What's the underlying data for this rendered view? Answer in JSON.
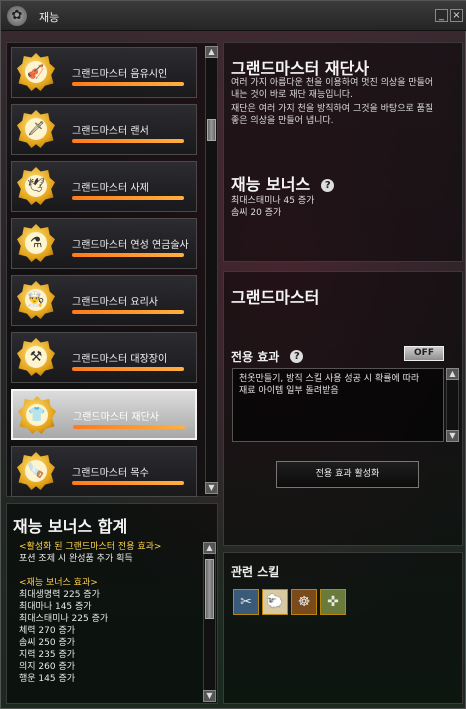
{
  "window": {
    "title": "재능",
    "minimize_label": "_",
    "close_label": "×"
  },
  "jobs": [
    {
      "name": "그랜드마스터 음유시인",
      "glyph": "🎻",
      "progress": 1.0,
      "selected": false
    },
    {
      "name": "그랜드마스터 랜서",
      "glyph": "🗡",
      "progress": 1.0,
      "selected": false
    },
    {
      "name": "그랜드마스터 사제",
      "glyph": "🕊",
      "progress": 1.0,
      "selected": false
    },
    {
      "name": "그랜드마스터 연성 연금술사",
      "glyph": "⚗",
      "progress": 1.0,
      "selected": false
    },
    {
      "name": "그랜드마스터 요리사",
      "glyph": "👨‍🍳",
      "progress": 1.0,
      "selected": false
    },
    {
      "name": "그랜드마스터 대장장이",
      "glyph": "⚒",
      "progress": 1.0,
      "selected": false
    },
    {
      "name": "그랜드마스터 재단사",
      "glyph": "👕",
      "progress": 1.0,
      "selected": true
    },
    {
      "name": "그랜드마스터 목수",
      "glyph": "🪚",
      "progress": 1.0,
      "selected": false
    }
  ],
  "info": {
    "title": "그랜드마스터 재단사",
    "desc1": "여러 가지 아름다운 천을 이용하여 멋진 의상을 만들어",
    "desc2": "내는 것이 바로 재단 재능입니다.",
    "desc3": "재단은 여러 가지 천을 방직하여 그것을 바탕으로 품질",
    "desc4": "좋은 의상을 만들어 냅니다.",
    "bonus_title": "재능 보너스",
    "bonus_line1": "최대스태미나 45 증가",
    "bonus_line2": "솜씨 20 증가"
  },
  "grandmaster": {
    "title": "그랜드마스터",
    "effect_label": "전용 효과",
    "toggle": "OFF",
    "effect_line1": "천옷만들기, 방직 스킬 사용 성공 시 확률에 따라",
    "effect_line2": "재료 아이템 일부 돌려받음",
    "activate_button": "전용 효과 활성화"
  },
  "skills": {
    "title": "관련 스킬",
    "icons": [
      "tailoring-icon",
      "sheep-icon",
      "spinning-wheel-icon",
      "weaving-icon"
    ]
  },
  "bonus_total": {
    "title": "재능 보너스 합계",
    "lines": [
      {
        "text": "<활성화 된 그랜드마스터 전용 효과>",
        "color": "yellow"
      },
      {
        "text": "포션 조제 시 완성품 추가 획득",
        "color": "white"
      },
      {
        "text": "",
        "color": "white"
      },
      {
        "text": "<재능 보너스 효과>",
        "color": "yellow"
      },
      {
        "text": "최대생명력 225 증가",
        "color": "white"
      },
      {
        "text": "최대마나 145 증가",
        "color": "white"
      },
      {
        "text": "최대스태미나 225 증가",
        "color": "white"
      },
      {
        "text": "체력 270 증가",
        "color": "white"
      },
      {
        "text": "솜씨 250 증가",
        "color": "white"
      },
      {
        "text": "지력 235 증가",
        "color": "white"
      },
      {
        "text": "의지 260 증가",
        "color": "white"
      },
      {
        "text": "행운 145 증가",
        "color": "white"
      }
    ]
  }
}
